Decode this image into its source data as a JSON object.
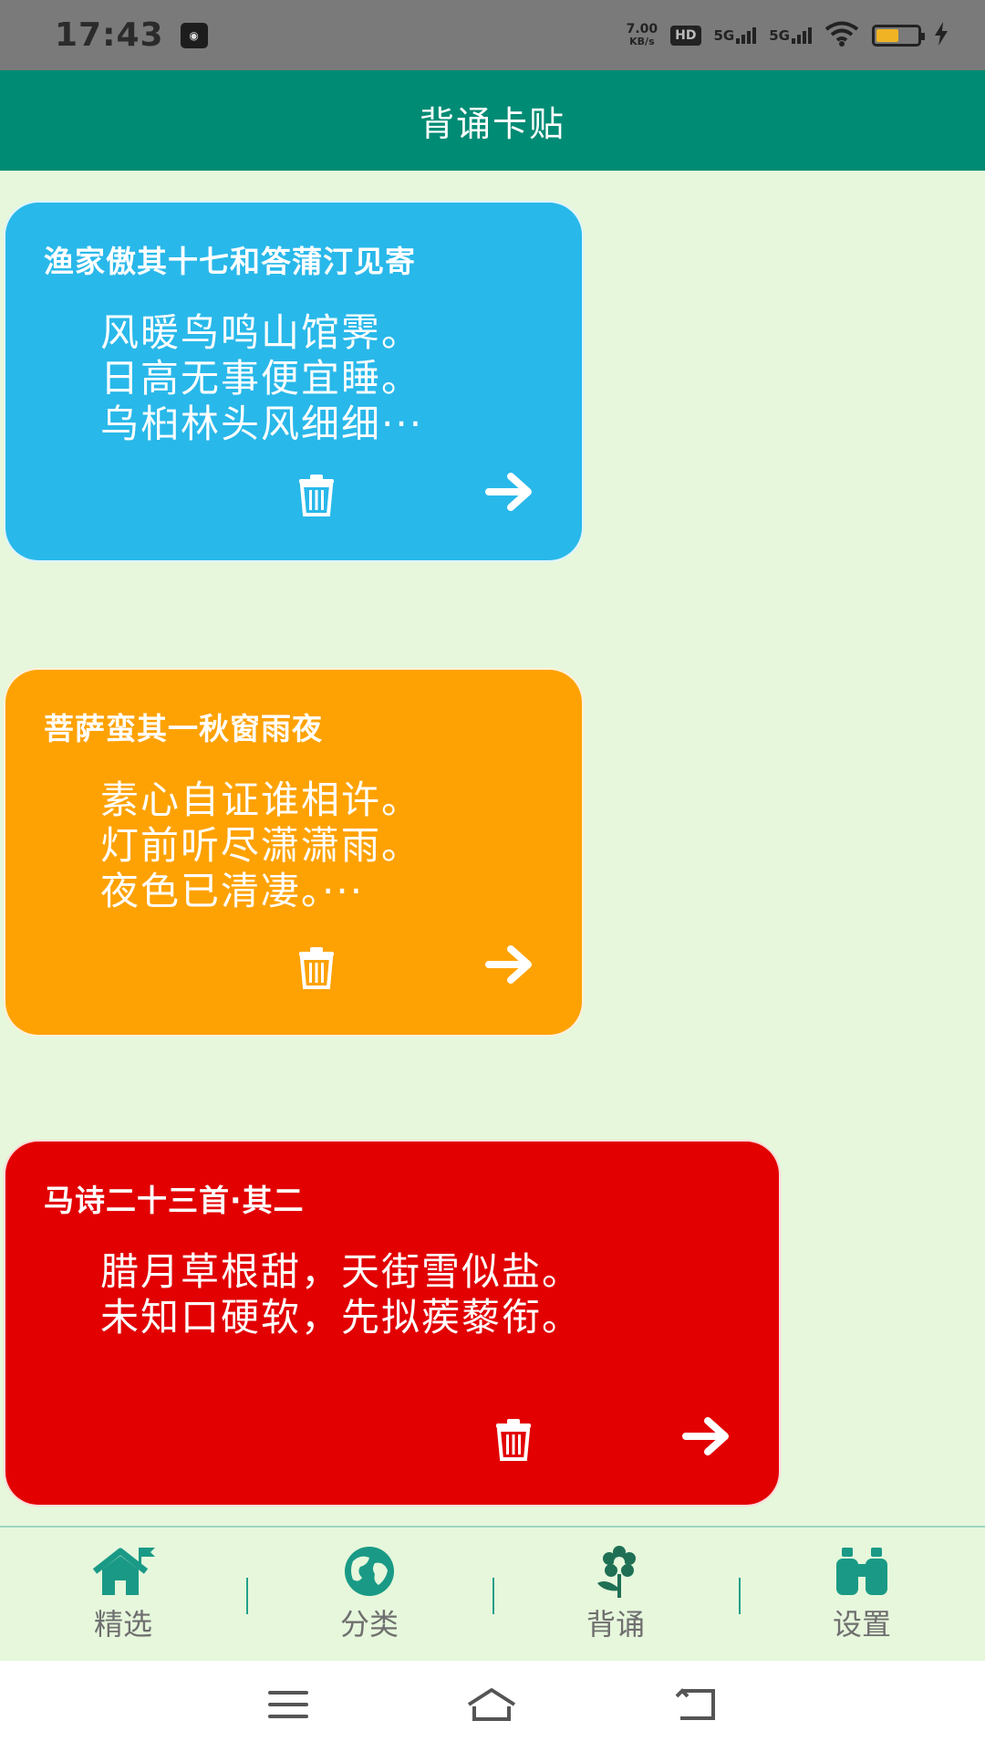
{
  "status_bar": {
    "time": "17:43",
    "net_speed_value": "7.00",
    "net_speed_unit": "KB/s",
    "hd_label": "HD",
    "signal1_label": "5G",
    "signal2_label": "5G",
    "battery_level": 0.55
  },
  "header": {
    "title": "背诵卡贴"
  },
  "cards": [
    {
      "title": "渔家傲其十七和答蒲汀见寄",
      "lines": [
        "风暖鸟鸣山馆霁。",
        "日高无事便宜睡。",
        "乌桕林头风细细···"
      ],
      "color": "#29b8ea"
    },
    {
      "title": "菩萨蛮其一秋窗雨夜",
      "lines": [
        "素心自证谁相许。",
        "灯前听尽潇潇雨。",
        "夜色已清凄。···"
      ],
      "color": "#fea203"
    },
    {
      "title": "马诗二十三首·其二",
      "lines": [
        "腊月草根甜，天街雪似盐。",
        "未知口硬软，先拟蒺藜衔。"
      ],
      "color": "#e20001"
    }
  ],
  "bottom_nav": [
    {
      "label": "精选",
      "icon": "home-icon"
    },
    {
      "label": "分类",
      "icon": "globe-icon"
    },
    {
      "label": "背诵",
      "icon": "flower-icon"
    },
    {
      "label": "设置",
      "icon": "binoculars-icon"
    }
  ],
  "colors": {
    "app_bar": "#008b74",
    "background": "#e6f7dc",
    "nav_icon": "#1a9a86"
  }
}
